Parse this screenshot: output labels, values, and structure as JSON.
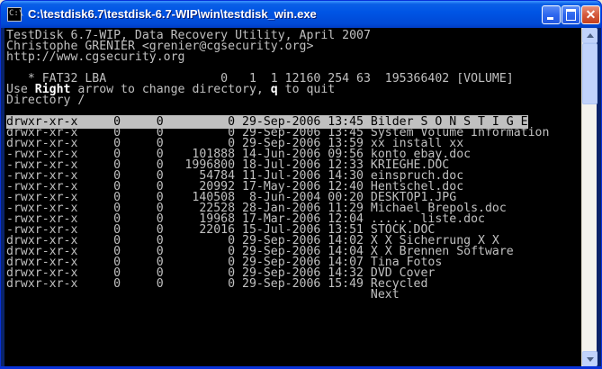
{
  "window": {
    "title": "C:\\testdisk6.7\\testdisk-6.7-WIP\\win\\testdisk_win.exe",
    "app_icon": "C:\\",
    "buttons": {
      "minimize": "minimize-icon",
      "maximize": "maximize-icon",
      "close": "close-icon"
    }
  },
  "console": {
    "header": [
      "TestDisk 6.7-WIP, Data Recovery Utility, April 2007",
      "Christophe GRENIER <grenier@cgsecurity.org>",
      "http://www.cgsecurity.org"
    ],
    "partition_line": "   * FAT32 LBA                0   1  1 12160 254 63  195366402 [VOLUME]",
    "instructions": {
      "prefix": "Use ",
      "right": "Right",
      "middle": " arrow to change directory, ",
      "q": "q",
      "suffix": " to quit"
    },
    "directory_line": "Directory /",
    "entries": [
      "drwxr-xr-x     0     0         0 29-Sep-2006 13:45 Bilder S O N S T I G E",
      "drwxr-xr-x     0     0         0 29-Sep-2006 13:45 System Volume Information",
      "drwxr-xr-x     0     0         0 29-Sep-2006 13:59 xx install xx",
      "-rwxr-xr-x     0     0    101888 14-Jun-2006 09:56 konto ebay.doc",
      "-rwxr-xr-x     0     0   1996800 18-Jul-2006 12:33 KRIEGHE.DOC",
      "-rwxr-xr-x     0     0     54784 11-Jul-2006 14:30 einspruch.doc",
      "-rwxr-xr-x     0     0     20992 17-May-2006 12:40 Hentschel.doc",
      "-rwxr-xr-x     0     0    140508  8-Jun-2004 00:20 DESKTOP1.JPG",
      "-rwxr-xr-x     0     0     22528 28-Jan-2006 11:29 Michael Brepols.doc",
      "-rwxr-xr-x     0     0     19968 17-Mar-2006 12:04 ...... liste.doc",
      "-rwxr-xr-x     0     0     22016 15-Jul-2006 13:51 STOCK.DOC",
      "drwxr-xr-x     0     0         0 29-Sep-2006 14:02 X X Sicherrung X X",
      "drwxr-xr-x     0     0         0 29-Sep-2006 14:04 X X Brennen Software",
      "drwxr-xr-x     0     0         0 29-Sep-2006 14:07 Tina Fotos",
      "drwxr-xr-x     0     0         0 29-Sep-2006 14:32 DVD Cover",
      "drwxr-xr-x     0     0         0 29-Sep-2006 15:49 Recycled"
    ],
    "next_line": "                                                   Next",
    "selected_index": 0
  },
  "scrollbar": {
    "position": 0
  },
  "colors": {
    "console_bg": "#000000",
    "console_fg": "#c0c0c0",
    "selection_bg": "#c0c0c0",
    "title_bar": "#0055e5"
  }
}
